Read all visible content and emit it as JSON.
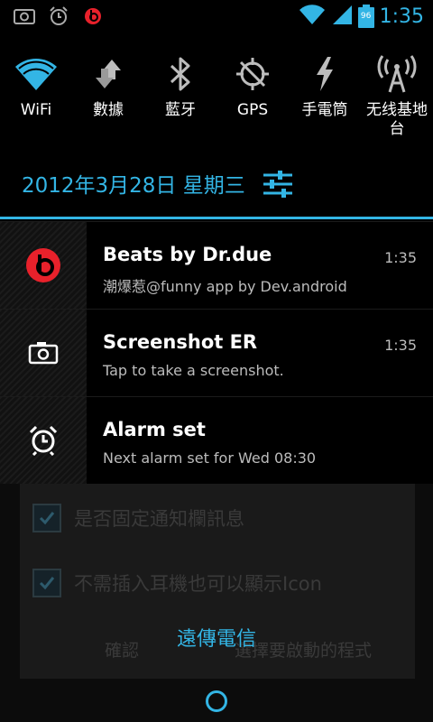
{
  "status_bar": {
    "left_icons": [
      "screenshot-icon",
      "alarm-clock-icon",
      "beats-icon"
    ],
    "battery_level": "96",
    "time": "1:35"
  },
  "quick_toggles": [
    {
      "label": "WiFi",
      "icon": "wifi-icon"
    },
    {
      "label": "數據",
      "icon": "data-arrows-icon"
    },
    {
      "label": "藍牙",
      "icon": "bluetooth-icon"
    },
    {
      "label": "GPS",
      "icon": "gps-icon"
    },
    {
      "label": "手電筒",
      "icon": "flashlight-icon"
    },
    {
      "label": "无线基地台",
      "icon": "hotspot-icon"
    }
  ],
  "date_row": {
    "date": "2012年3月28日 星期三"
  },
  "notifications": [
    {
      "title": "Beats by Dr.due",
      "text": "潮爆惹@funny app by Dev.android",
      "time": "1:35",
      "icon": "beats-icon"
    },
    {
      "title": "Screenshot ER",
      "text": "Tap to take a screenshot.",
      "time": "1:35",
      "icon": "camera-icon"
    },
    {
      "title": "Alarm set",
      "text": "Next alarm set for Wed 08:30",
      "time": "",
      "icon": "alarm-clock-icon"
    }
  ],
  "background_dialog": {
    "options": [
      "是否固定通知欄訊息",
      "不需插入耳機也可以顯示Icon"
    ],
    "confirm": "確認",
    "choose_app": "選擇要啟動的程式"
  },
  "carrier": "遠傳電信",
  "colors": {
    "accent": "#33b5e5",
    "beats_red": "#e8212b"
  }
}
